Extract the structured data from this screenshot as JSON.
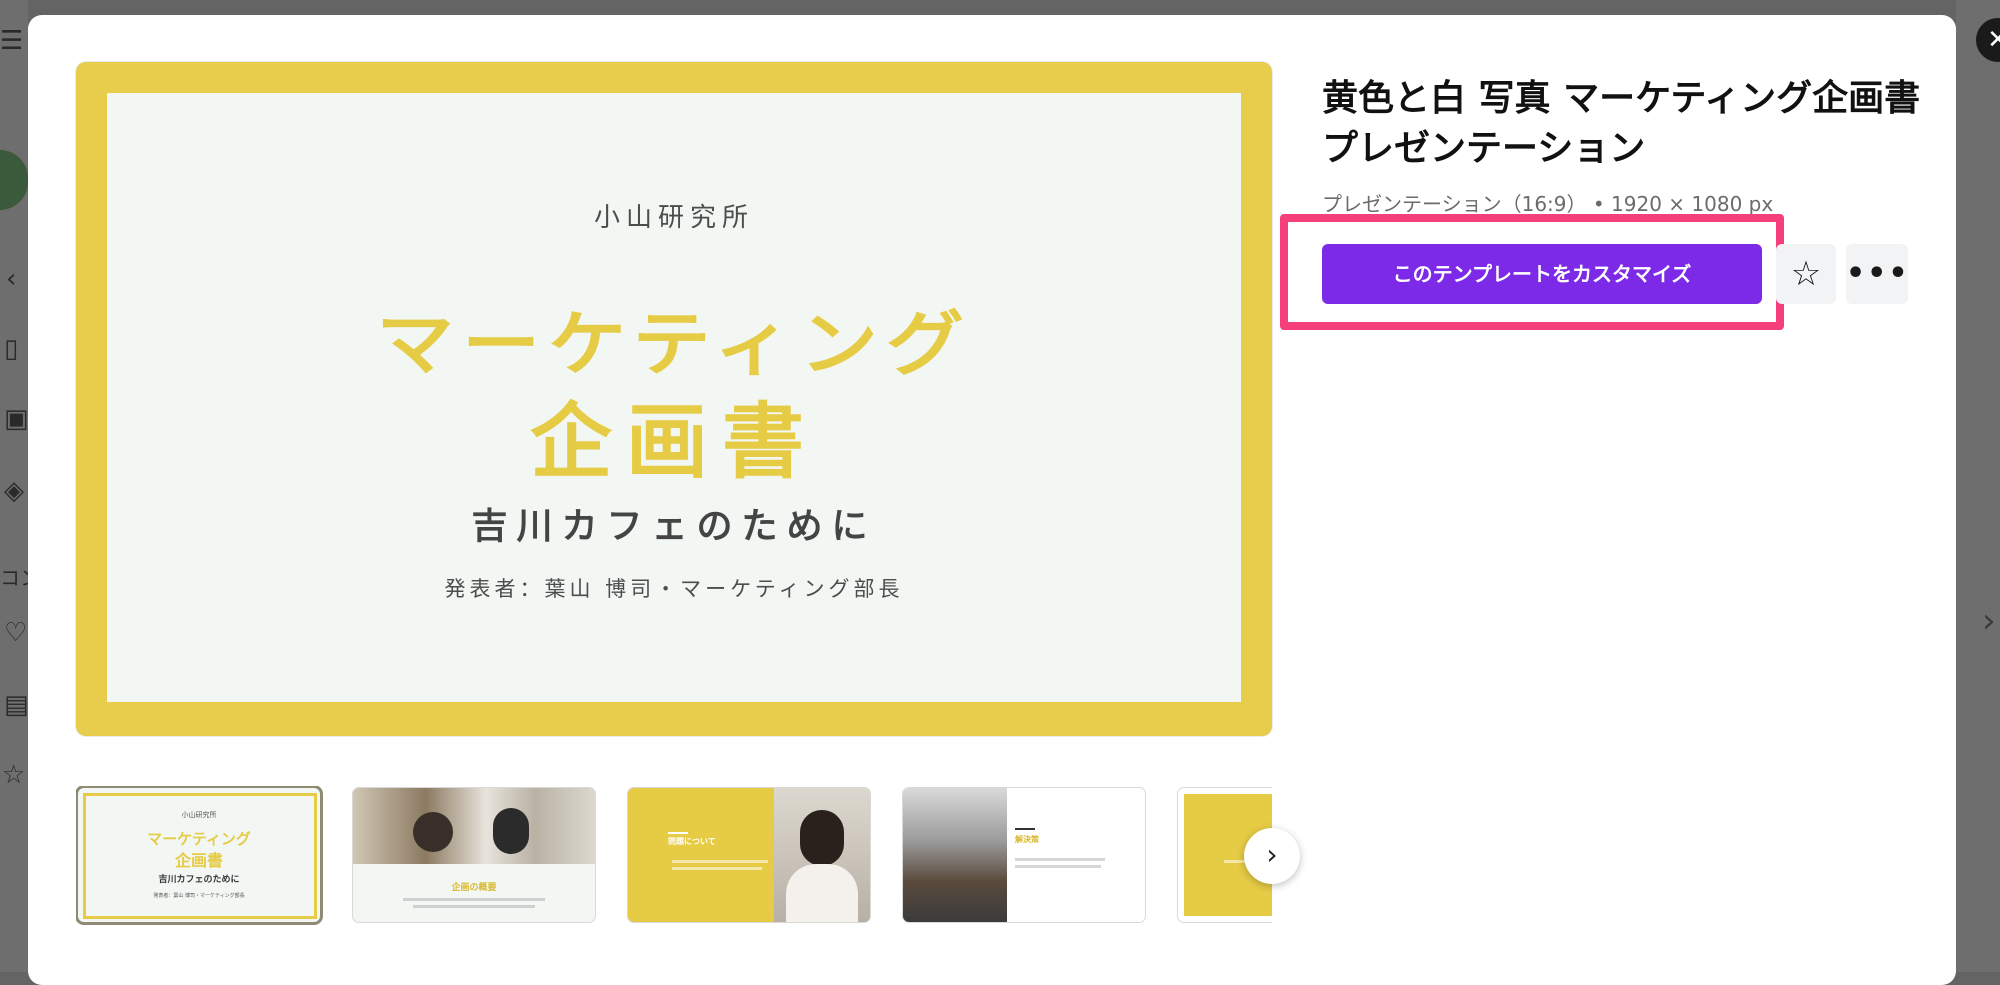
{
  "template": {
    "title": "黄色と白 写真 マーケティング企画書 プレゼンテーション",
    "meta": "プレゼンテーション（16:9） • 1920 × 1080 px",
    "customize_label": "このテンプレートをカスタマイズ"
  },
  "preview": {
    "lab": "小山研究所",
    "title_line1": "マーケティング",
    "title_line2": "企画書",
    "subtitle": "吉川カフェのために",
    "presenter": "発表者：葉山 博司・マーケティング部長"
  },
  "thumbnails": [
    {
      "lab": "小山研究所",
      "title_line1": "マーケティング",
      "title_line2": "企画書",
      "subtitle": "吉川カフェのために",
      "presenter": "発表者：葉山 博司・マーケティング部長"
    },
    {
      "heading": "企画の概要"
    },
    {
      "heading": "問題について"
    },
    {
      "heading": "解決策"
    }
  ],
  "background": {
    "sidebar_text": "コン"
  },
  "icons": {
    "close": "close-icon",
    "star": "star-icon",
    "more": "more-icon",
    "next": "chevron-right-icon"
  },
  "colors": {
    "accent_purple": "#7d2ae8",
    "highlight_pink": "#f43f7a",
    "slide_yellow": "#e8cc4b",
    "slide_bg": "#f3f7f4"
  }
}
